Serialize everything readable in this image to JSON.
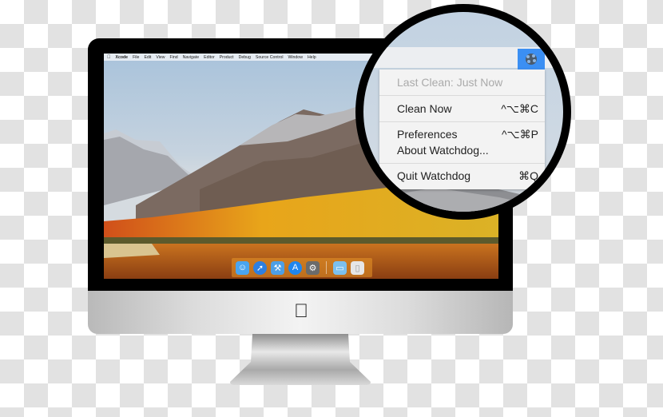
{
  "menubar": {
    "apple": "",
    "app_name": "Xcode",
    "items": [
      "File",
      "Edit",
      "View",
      "Find",
      "Navigate",
      "Editor",
      "Product",
      "Debug",
      "Source Control",
      "Window",
      "Help"
    ]
  },
  "dock": {
    "apps": [
      {
        "name": "Finder",
        "icon": "finder-icon",
        "color": "#4aa5ef",
        "glyph": "☺"
      },
      {
        "name": "Safari",
        "icon": "safari-icon",
        "color": "#2d7fe0",
        "glyph": "➚"
      },
      {
        "name": "Xcode",
        "icon": "xcode-icon",
        "color": "#4d9fe6",
        "glyph": "⚒"
      },
      {
        "name": "App Store",
        "icon": "app-store-icon",
        "color": "#1f86f0",
        "glyph": "A"
      },
      {
        "name": "System Preferences",
        "icon": "system-preferences-icon",
        "color": "#6b6b6b",
        "glyph": "⚙"
      }
    ],
    "folders": [
      {
        "name": "Downloads",
        "icon": "folder-icon",
        "color": "#7cc0ee",
        "glyph": "▭"
      },
      {
        "name": "Trash",
        "icon": "trash-icon",
        "color": "#e6e6e6",
        "glyph": "▯"
      }
    ]
  },
  "status_menu": {
    "app": "Watchdog",
    "status_icon": "watchdog-icon",
    "highlight_color": "#3b8ff3",
    "items": [
      {
        "label": "Last Clean: Just Now",
        "shortcut": "",
        "disabled": true
      },
      {
        "label": "Clean Now",
        "shortcut": "^⌥⌘C",
        "disabled": false
      },
      {
        "label": "Preferences",
        "shortcut": "^⌥⌘P",
        "disabled": false
      },
      {
        "label": "About Watchdog...",
        "shortcut": "",
        "disabled": false
      },
      {
        "label": "Quit Watchdog",
        "shortcut": "⌘Q",
        "disabled": false
      }
    ]
  },
  "hardware": {
    "logo": ""
  }
}
